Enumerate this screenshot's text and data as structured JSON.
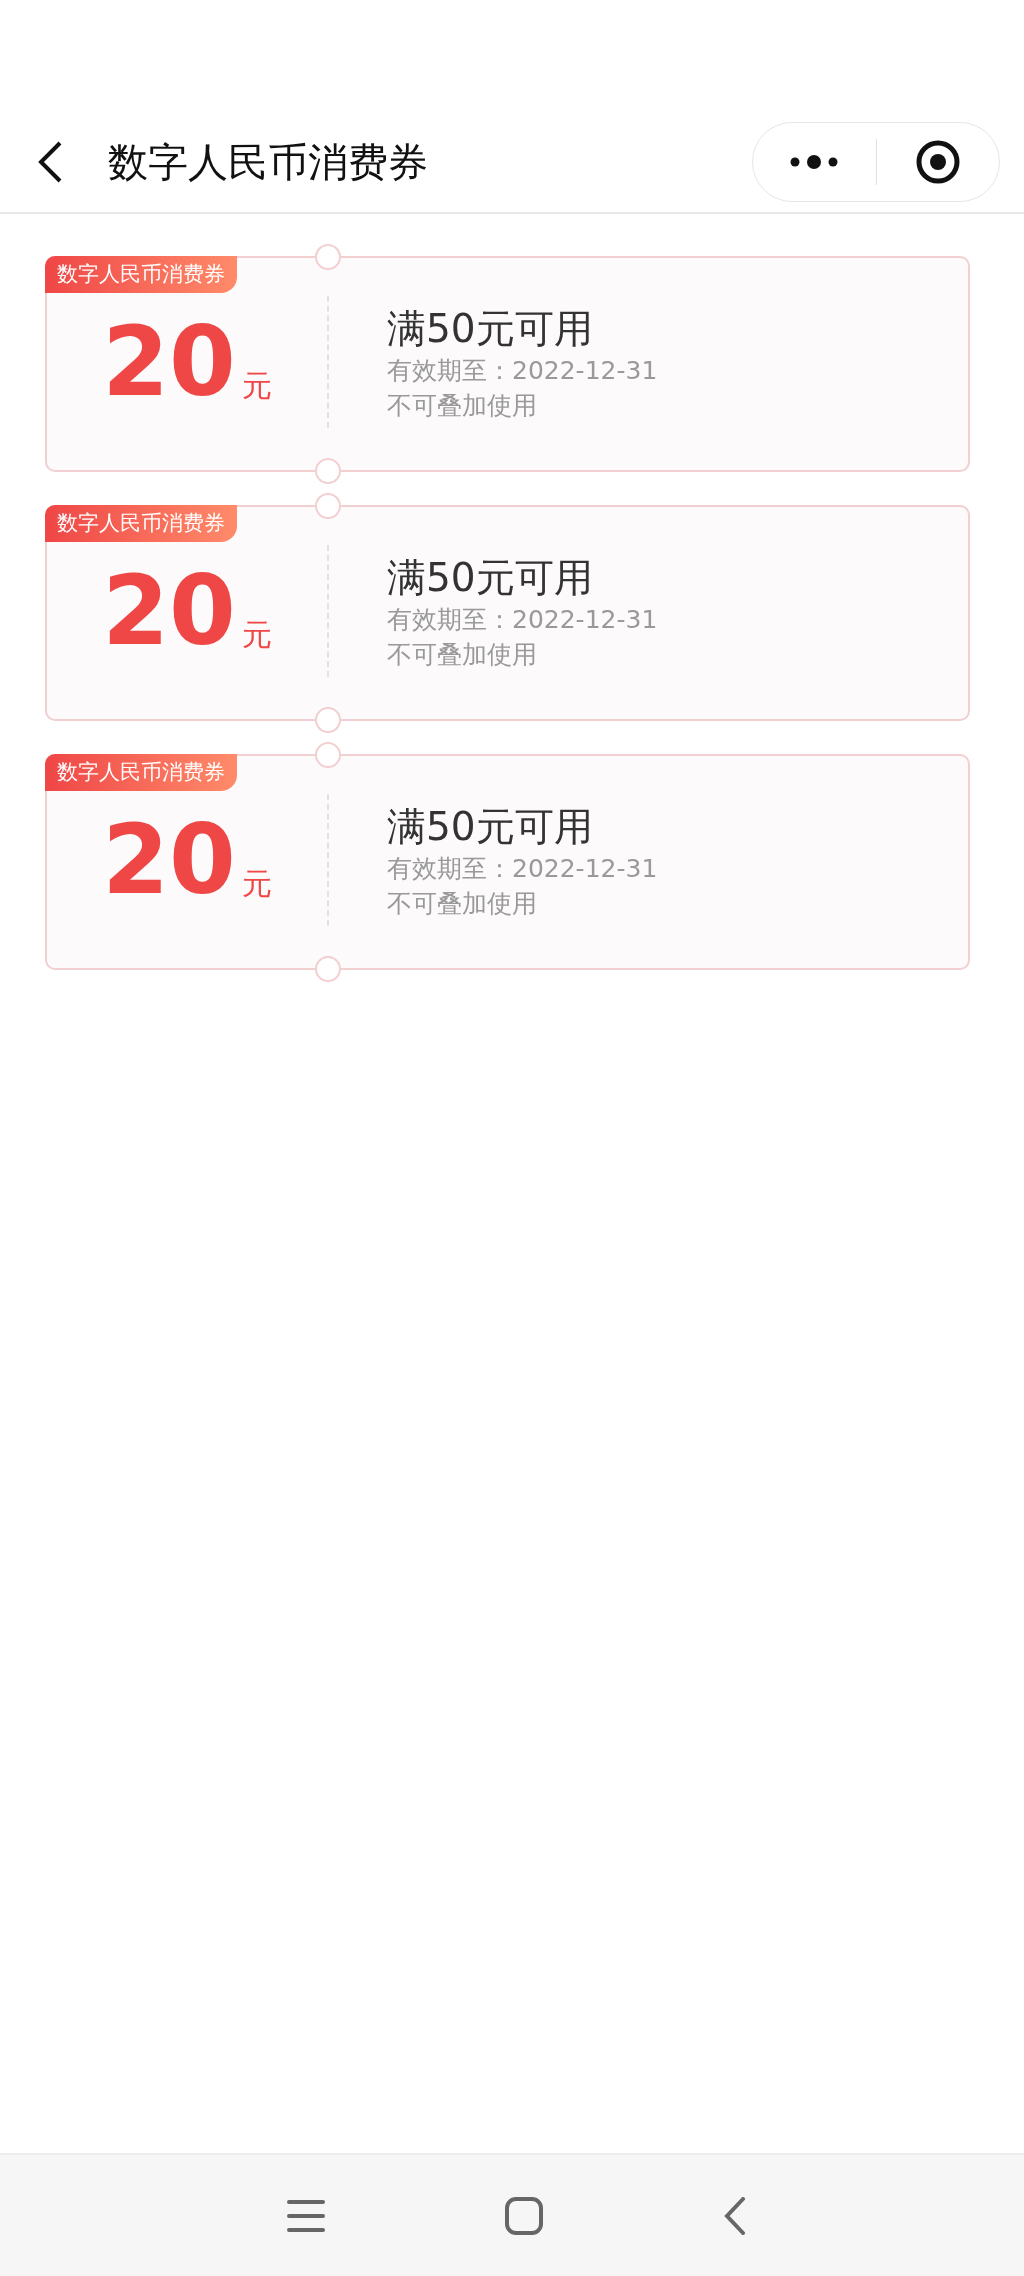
{
  "header": {
    "title": "数字人民币消费券"
  },
  "coupons": [
    {
      "tag": "数字人民币消费券",
      "amount": "20",
      "unit": "元",
      "condition": "满50元可用",
      "expiry": "有效期至：2022-12-31",
      "note": "不可叠加使用"
    },
    {
      "tag": "数字人民币消费券",
      "amount": "20",
      "unit": "元",
      "condition": "满50元可用",
      "expiry": "有效期至：2022-12-31",
      "note": "不可叠加使用"
    },
    {
      "tag": "数字人民币消费券",
      "amount": "20",
      "unit": "元",
      "condition": "满50元可用",
      "expiry": "有效期至：2022-12-31",
      "note": "不可叠加使用"
    }
  ]
}
